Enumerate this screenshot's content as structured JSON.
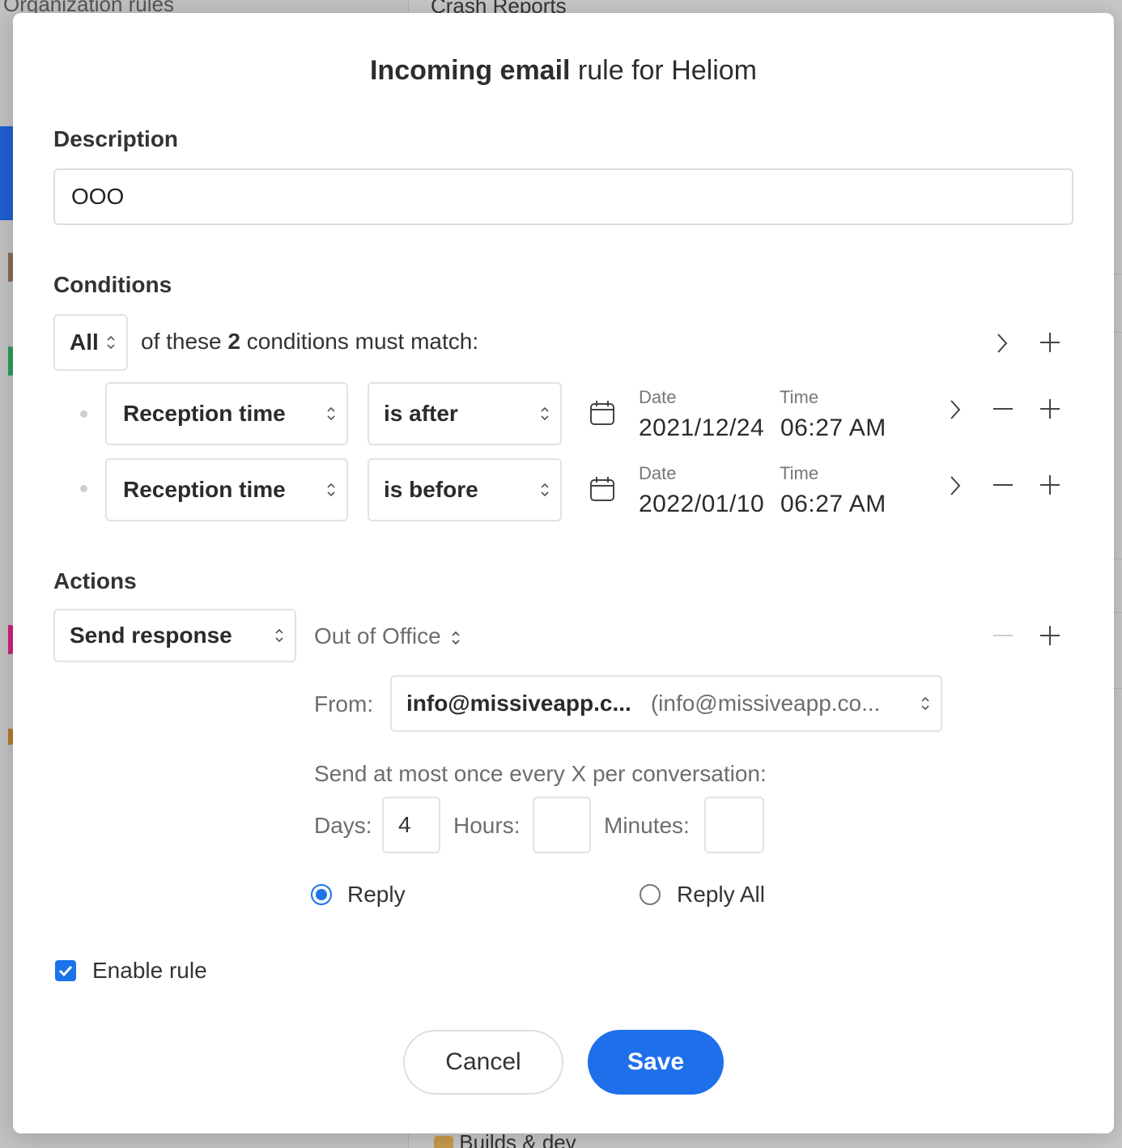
{
  "background": {
    "left_header": "Organization rules",
    "right_header": "Crash Reports",
    "bottom_item": "Builds & dev",
    "bottom_item_icon": "construction-worker-icon"
  },
  "modal": {
    "title_bold": "Incoming email",
    "title_rest": " rule for Heliom"
  },
  "description": {
    "label": "Description",
    "value": "OOO"
  },
  "conditions": {
    "label": "Conditions",
    "match_select": "All",
    "match_text_pre": "of these ",
    "match_count": "2",
    "match_text_post": " conditions must match:",
    "rows": [
      {
        "field": "Reception time",
        "operator": "is after",
        "date_label": "Date",
        "time_label": "Time",
        "date": "2021/12/24",
        "time": "06:27 AM"
      },
      {
        "field": "Reception time",
        "operator": "is before",
        "date_label": "Date",
        "time_label": "Time",
        "date": "2022/01/10",
        "time": "06:27 AM"
      }
    ]
  },
  "actions": {
    "label": "Actions",
    "action_select": "Send response",
    "template_select": "Out of Office",
    "from_label": "From:",
    "from_name": "info@missiveapp.c...",
    "from_address": "(info@missiveapp.co...",
    "frequency_text": "Send at most once every X per conversation:",
    "days_label": "Days:",
    "days_value": "4",
    "hours_label": "Hours:",
    "hours_value": "",
    "minutes_label": "Minutes:",
    "minutes_value": "",
    "reply_label": "Reply",
    "reply_all_label": "Reply All",
    "reply_selected": true
  },
  "enable_rule": {
    "label": "Enable rule",
    "checked": true
  },
  "buttons": {
    "cancel": "Cancel",
    "save": "Save"
  },
  "colors": {
    "accent": "#1a73e8",
    "save_button": "#1f6feb"
  }
}
